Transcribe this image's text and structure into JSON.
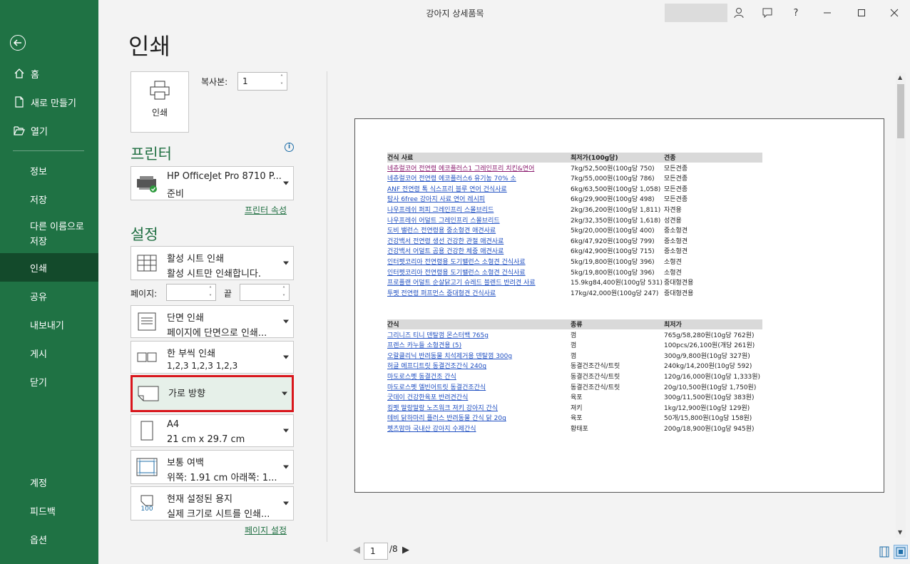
{
  "window": {
    "title": "강아지 상세품목",
    "help": "?"
  },
  "nav": {
    "top": [
      {
        "label": "홈",
        "icon": "home-icon"
      },
      {
        "label": "새로 만들기",
        "icon": "new-doc-icon"
      },
      {
        "label": "열기",
        "icon": "folder-open-icon"
      }
    ],
    "items": [
      "정보",
      "저장",
      "다른 이름으로",
      "저장",
      "인쇄",
      "공유",
      "내보내기",
      "게시",
      "닫기"
    ],
    "bottom": [
      "계정",
      "피드백",
      "옵션"
    ]
  },
  "print": {
    "heading": "인쇄",
    "print_label": "인쇄",
    "copies_label": "복사본:",
    "copies_value": "1"
  },
  "printer": {
    "section": "프린터",
    "name": "HP OfficeJet Pro 8710 P...",
    "status": "준비",
    "properties_link": "프린터 속성"
  },
  "settings": {
    "section": "설정",
    "scope": {
      "line1": "활성 시트 인쇄",
      "line2": "활성 시트만 인쇄합니다."
    },
    "pages_label": "페이지:",
    "to_label": "끝",
    "sides": {
      "line1": "단면 인쇄",
      "line2": "페이지에 단면으로 인쇄..."
    },
    "collate": {
      "line1": "한 부씩 인쇄",
      "line2": "1,2,3     1,2,3     1,2,3"
    },
    "orientation": {
      "line1": "가로 방향"
    },
    "paper": {
      "line1": "A4",
      "line2": "21 cm x 29.7 cm"
    },
    "margins": {
      "line1": "보통 여백",
      "line2": "위쪽: 1.91 cm 아래쪽: 1..."
    },
    "scaling": {
      "line1": "현재 설정된 용지",
      "line2": "실제 크기로 시트를 인쇄...",
      "icon_text": "100"
    },
    "page_setup_link": "페이지 설정"
  },
  "preview": {
    "page_current": "1",
    "page_total": "/8",
    "table1_header": [
      "건식 사료",
      "최저가(100g당)",
      "견종"
    ],
    "table1_rows": [
      [
        "네츄럴코어 전연령 에코플러스1 그레인프리 치킨&연어",
        "7kg/52,500원(100g당 750)",
        "모든견종"
      ],
      [
        "네츄럴코어 전연령 에코플러스6 유기농 70% 소",
        "7kg/55,000원(100g당 786)",
        "모든견종"
      ],
      [
        "ANF 전연령 톡 식스프리 블루 연어 건식사료",
        "6kg/63,500원(100g당 1,058)",
        "모든견종"
      ],
      [
        "탐사 6free 강아지 사료 연어 레시피",
        "6kg/29,900원(100g당 498)",
        "모든견종"
      ],
      [
        "나우프레쉬 퍼피 그레인프리 스몰브리드",
        "2kg/36,200원(100g당 1,811)",
        "자견용"
      ],
      [
        "나우프레쉬 어덜트 그레인프리 스몰브리드",
        "2kg/32,350원(100g당 1,618)",
        "성견용"
      ],
      [
        "도비 밸런스 전연령용 중소형견 애견사료",
        "5kg/20,000원(100g당 400)",
        "중소형견"
      ],
      [
        "건강백서 전연령 생선 건강한 관절 애견사료",
        "6kg/47,920원(100g당 799)",
        "중소형견"
      ],
      [
        "건강백서 어덜트 곰용 건강한 체중 애견사료",
        "6kg/42,900원(100g당 715)",
        "중소형견"
      ],
      [
        "인터펫코리아 전연령용 도기밸런스 소형견 건식사료",
        "5kg/19,800원(100g당 396)",
        "소형견"
      ],
      [
        "인터펫코리아 전연령용 도기밸런스 소형견 건식사료",
        "5kg/19,800원(100g당 396)",
        "소형견"
      ],
      [
        "프로플랜 어덜트 순살닭고기 슈레드 블렌드 반려견 사료",
        "15.9kg84,400원(100g당 531)",
        "중대형견용"
      ],
      [
        "투펫 전연령 퍼프먼스 중대형견 건식사료",
        "17kg/42,000원(100g당 247)",
        "중대형견용"
      ]
    ],
    "table2_header": [
      "간식",
      "종류",
      "최저가"
    ],
    "table2_rows": [
      [
        "그리니즈 티니 덴탈껌 몬스터백 765g",
        "껌",
        "765g/58,280원(10g당 762원)"
      ],
      [
        "프렌스 카누들 소형견용 (5)",
        "껌",
        "100pcs/26,100원(개당 261원)"
      ],
      [
        "오랄클리닉 반려동물 치석제거용 덴탈껌 300g",
        "껌",
        "300g/9,800원(10g당 327원)"
      ],
      [
        "허글 에프디트릿 동결건조간식 240g",
        "동결건조간식/트릿",
        "240kg/14,200원(10g당 592)"
      ],
      [
        "마도로스펫 동결건조 간식",
        "동결건조간식/트릿",
        "120g/16,000원(10g당 1,333원)"
      ],
      [
        "마도로스펫 엘빈어트릿 동결건조간식",
        "동결건조간식/트릿",
        "20g/10,500원(10g당 1,750원)"
      ],
      [
        "굿데이 건강한육포 반려견간식",
        "육포",
        "300g/11,500원(10g당 383원)"
      ],
      [
        "킹펫 말랑말랑 노즈워크 져키 강아지 간식",
        "져키",
        "1kg/12,900원(10g당 129원)"
      ],
      [
        "테비 닭하마리 플러스 반려동물 간식 닭 20g",
        "육포",
        "50개/15,800원(10g당 158원)"
      ],
      [
        "펫츠맘마 국내산 강아지 수제간식",
        "황태포",
        "200g/18,900원(10g당 945원)"
      ]
    ]
  },
  "colors": {
    "nav_bg": "#1f7244",
    "nav_active": "#134a2b",
    "accent": "#1e6e40",
    "highlight_border": "#d9161c"
  }
}
